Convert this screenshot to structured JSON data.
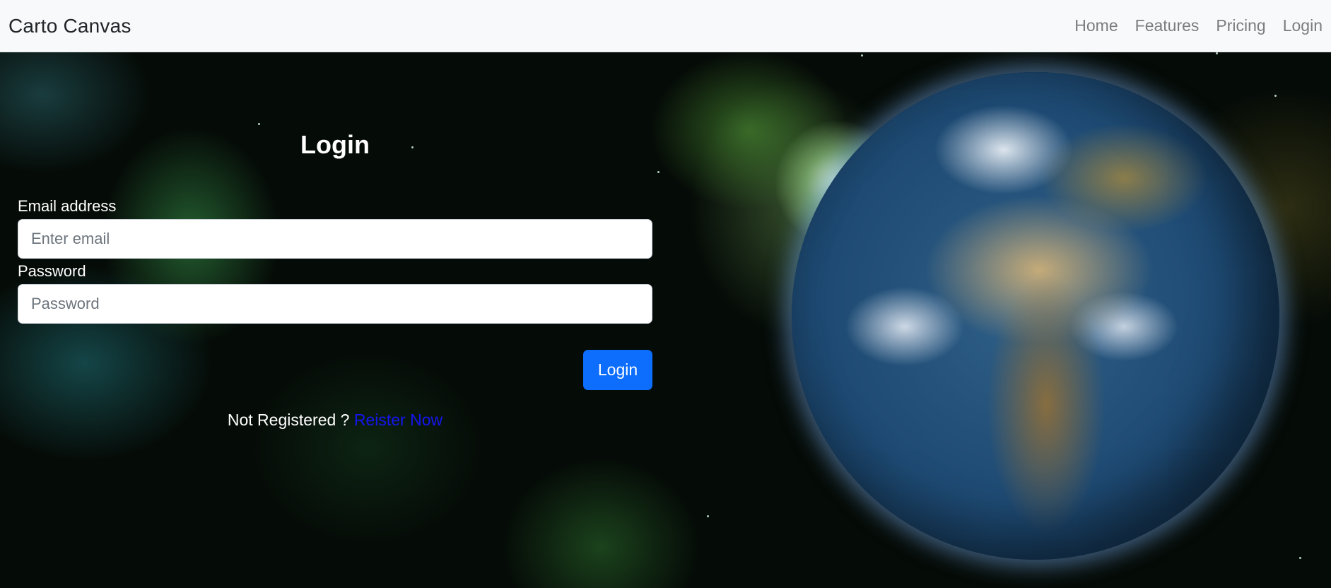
{
  "navbar": {
    "brand": "Carto Canvas",
    "links": [
      "Home",
      "Features",
      "Pricing",
      "Login"
    ]
  },
  "login_form": {
    "title": "Login",
    "email_label": "Email address",
    "email_placeholder": "Enter email",
    "password_label": "Password",
    "password_placeholder": "Password",
    "submit_label": "Login",
    "register_prompt": "Not Registered ?",
    "register_link": "Reister Now"
  },
  "colors": {
    "navbar_bg": "#f8f9fa",
    "primary_button": "#0d6efd",
    "register_link": "#1515ee",
    "nav_link": "#7a7d80"
  },
  "background": {
    "image_subject": "earth-in-space"
  }
}
